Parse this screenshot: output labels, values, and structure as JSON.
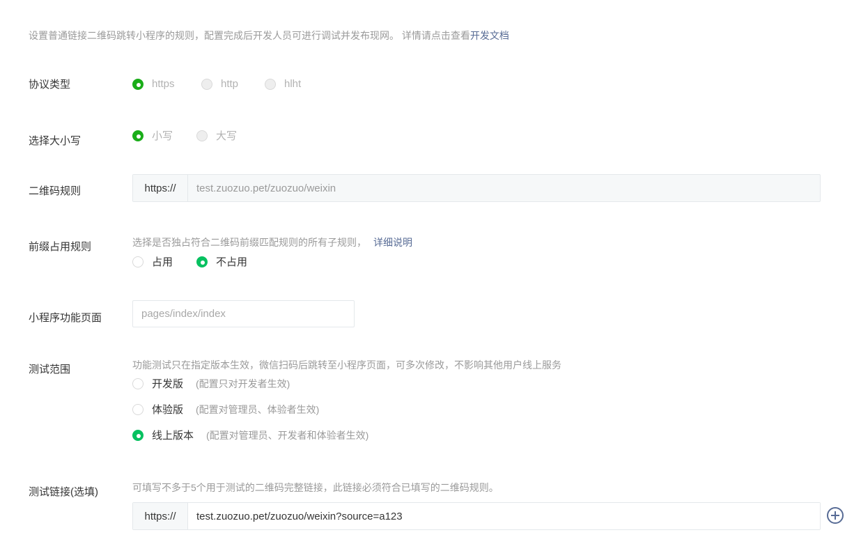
{
  "intro": {
    "text": "设置普通链接二维码跳转小程序的规则，配置完成后开发人员可进行调试并发布现网。 详情请点击查看",
    "link": "开发文档"
  },
  "protocol": {
    "label": "协议类型",
    "options": [
      "https",
      "http",
      "hlht"
    ],
    "selected": "https"
  },
  "case": {
    "label": "选择大小写",
    "options": [
      "小写",
      "大写"
    ],
    "selected": "小写"
  },
  "qr_rule": {
    "label": "二维码规则",
    "prefix": "https://",
    "value": "test.zuozuo.pet/zuozuo/weixin"
  },
  "prefix_rule": {
    "label": "前缀占用规则",
    "desc": "选择是否独占符合二维码前缀匹配规则的所有子规则，",
    "link": "详细说明",
    "options": [
      "占用",
      "不占用"
    ],
    "selected": "不占用"
  },
  "page": {
    "label": "小程序功能页面",
    "placeholder": "pages/index/index"
  },
  "test_scope": {
    "label": "测试范围",
    "desc": "功能测试只在指定版本生效，微信扫码后跳转至小程序页面，可多次修改，不影响其他用户线上服务",
    "options": [
      {
        "name": "开发版",
        "note": "(配置只对开发者生效)"
      },
      {
        "name": "体验版",
        "note": "(配置对管理员、体验者生效)"
      },
      {
        "name": "线上版本",
        "note": "(配置对管理员、开发者和体验者生效)"
      }
    ],
    "selected": "线上版本"
  },
  "test_link": {
    "label": "测试链接(选填)",
    "desc": "可填写不多于5个用于测试的二维码完整链接，此链接必须符合已填写的二维码规则。",
    "prefix": "https://",
    "value": "test.zuozuo.pet/zuozuo/weixin?source=a123"
  },
  "colors": {
    "accent_green": "#07c160",
    "link_blue": "#576b95"
  }
}
